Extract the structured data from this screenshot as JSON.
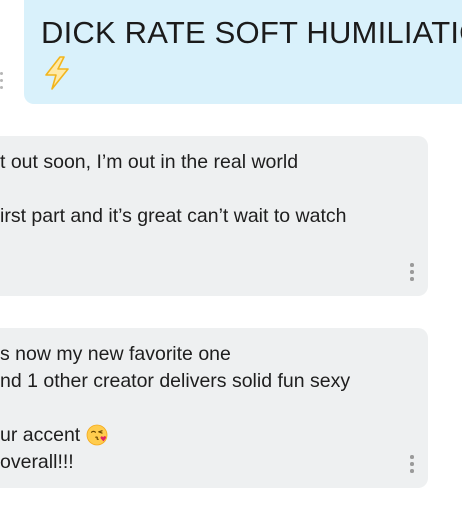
{
  "post": {
    "title": "DICK RATE SOFT HUMILIATION",
    "title_emoji": "high-voltage-emoji"
  },
  "comments": [
    {
      "lines": [
        "t out soon, I’m out in the real world",
        "irst part and it’s great can’t wait to watch"
      ]
    },
    {
      "lines": [
        "s now my new favorite one",
        "nd 1 other creator delivers solid fun sexy",
        "ur accent",
        "overall!!!"
      ],
      "emoji": "face-blowing-a-kiss-emoji"
    }
  ],
  "colors": {
    "title_card_bg": "#d9f1fb",
    "comment_card_bg": "#eef0f1",
    "text": "#1e1e1e",
    "lightning_yellow": "#ffc83d"
  }
}
